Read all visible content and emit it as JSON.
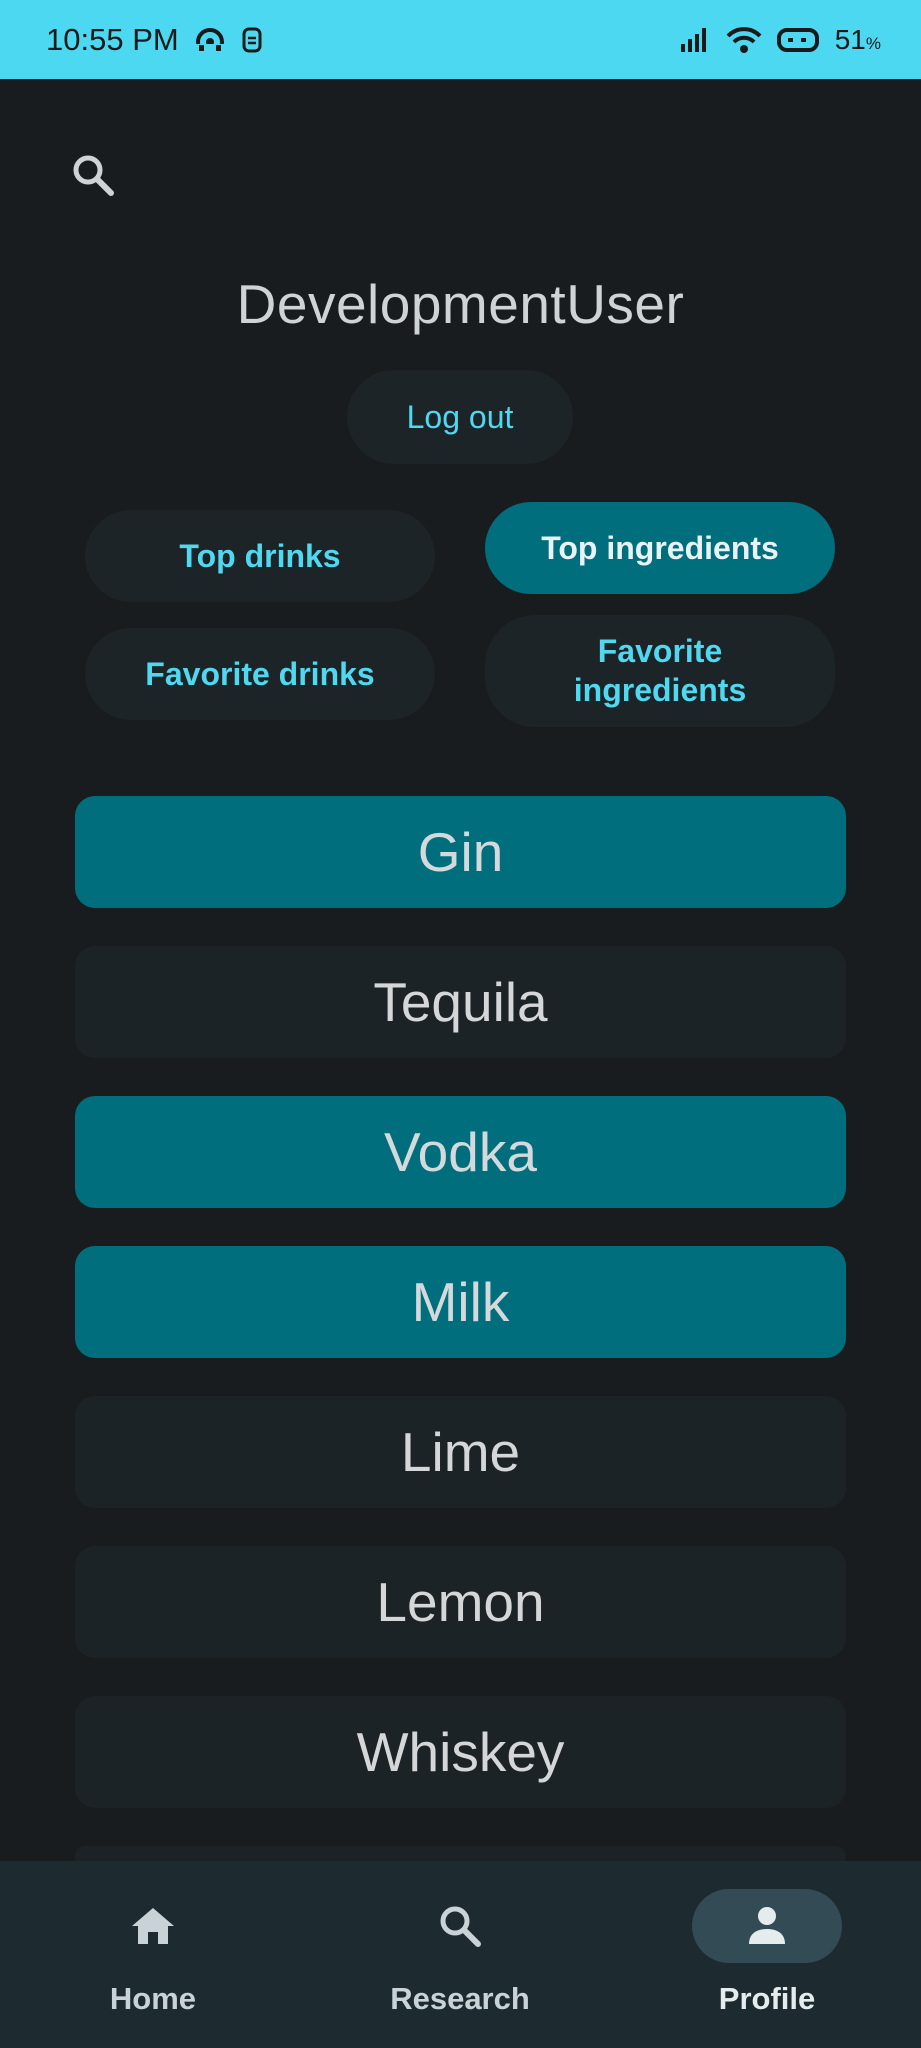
{
  "status_bar": {
    "time": "10:55 PM",
    "battery": "51",
    "battery_unit": "%",
    "icons": [
      "hotspot-icon",
      "sim-toolkit-icon",
      "signal-icon",
      "wifi-icon",
      "battery-icon"
    ]
  },
  "header": {
    "search_icon": "search-icon"
  },
  "profile": {
    "username": "DevelopmentUser",
    "logout_label": "Log out"
  },
  "tabs": [
    {
      "label": "Top drinks",
      "active": false
    },
    {
      "label": "Top ingredients",
      "active": true
    },
    {
      "label": "Favorite drinks",
      "active": false
    },
    {
      "label": "Favorite ingredients",
      "active": false
    }
  ],
  "ingredients": [
    {
      "label": "Gin",
      "highlighted": true
    },
    {
      "label": "Tequila",
      "highlighted": false
    },
    {
      "label": "Vodka",
      "highlighted": true
    },
    {
      "label": "Milk",
      "highlighted": true
    },
    {
      "label": "Lime",
      "highlighted": false
    },
    {
      "label": "Lemon",
      "highlighted": false
    },
    {
      "label": "Whiskey",
      "highlighted": false
    }
  ],
  "bottom_nav": [
    {
      "label": "Home",
      "icon": "home-icon",
      "active": false
    },
    {
      "label": "Research",
      "icon": "search-icon",
      "active": false
    },
    {
      "label": "Profile",
      "icon": "person-icon",
      "active": true
    }
  ],
  "colors": {
    "status_bar": "#4dd8f1",
    "background": "#191c1e",
    "accent_text": "#4fd8f0",
    "active_fill": "#016e7d",
    "inactive_fill": "#1c2427",
    "nav_background": "#1d2a30"
  }
}
